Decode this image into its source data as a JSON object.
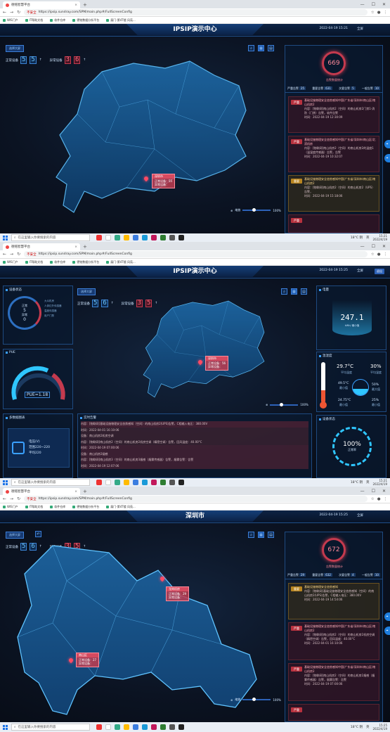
{
  "browser": {
    "tab_title": "德铭智慧平台",
    "url": "https://ipsip.sundray.com/SPM/main.php#/FullScreenConfig",
    "not_secure": "不安全",
    "new_tab": "+",
    "back": "←",
    "forward": "→",
    "reload": "↻",
    "home": "⌂",
    "minimize": "—",
    "maximize": "☐",
    "close": "✕",
    "tab_close": "×",
    "bookmarks": [
      "WIS门户",
      "IT帮助文档",
      "软件仓库",
      "德铭数据分析平台",
      "厦门-第4T楼 风苑..."
    ]
  },
  "taskbar": {
    "search_placeholder": "在这里输入你要搜索的内容",
    "weather": "18°C 阴",
    "lang": "英",
    "times": [
      {
        "time": "15:21",
        "date": "2022/4/19"
      },
      {
        "time": "15:21",
        "date": "2022/4/19"
      },
      {
        "time": "15:25",
        "date": "2022/4/19"
      }
    ]
  },
  "screen1": {
    "title": "IPSIP演示中心",
    "datetime": "2022-04-19  15:21",
    "fullscreen": "全屏",
    "select_btn": "选择大屏",
    "normal_label": "正常设备",
    "normal_digits": [
      "5",
      "5"
    ],
    "abnormal_label": "异常设备",
    "abnormal_digits": [
      "3",
      "6"
    ],
    "arrow": "↑",
    "ring_value": "669",
    "ring_label": "告警数量统计",
    "levels": [
      {
        "l": "严重告警",
        "v": "25"
      },
      {
        "l": "重要告警",
        "v": "631"
      },
      {
        "l": "次要告警",
        "v": "5"
      },
      {
        "l": "一般告警",
        "v": "10"
      }
    ],
    "popup": {
      "title": "深圳市",
      "normal": "正常设备：55",
      "abnormal": "异常设备："
    },
    "alerts": [
      {
        "badge": "严重",
        "color": "red",
        "title": "基础设施物理安全态势感知中国/广东省/深圳市/南山区/南山机房2",
        "body": "内容：[物联网]南山机房2（空间）的南山机房2门禁1-消防（门禁）告警，软件告警",
        "time": "时间：2022-04-19 12:30:09"
      },
      {
        "badge": "严重",
        "color": "red",
        "title": "基础设施物理安全态势感知中国/广东省/深圳市/南山区/北滨机房",
        "body": "内容：[物联网]南山机房2（空间）的南山机房2的温度1（温湿度传感器）告警，告警",
        "time": "时间：2022-04-19 10:32:07"
      },
      {
        "badge": "重要",
        "color": "gold",
        "title": "基础设施物理安全态势感知中国/广东省/深圳市/南山区/南山机房2",
        "body": "内容：[物联网]南山机房2（空间）的南山机房2（UPS）告警，",
        "time": "时间：2022-04-19 15:18:06"
      },
      {
        "badge": "严重",
        "color": "red",
        "title": "",
        "body": "",
        "time": ""
      }
    ],
    "zoom": "100%",
    "zoom_label": "缩放"
  },
  "screen2": {
    "title": "IPSIP演示中心",
    "datetime": "2022-04-19  15:25",
    "fullscreen": "全屏",
    "exit": "退出",
    "select_btn": "选择大屏",
    "normal_label": "正常设备",
    "normal_digits": [
      "5",
      "6"
    ],
    "abnormal_label": "异常设备",
    "abnormal_digits": [
      "3",
      "5"
    ],
    "arrow": "↑",
    "dev_status": {
      "title": "设备状态",
      "normal_label": "正常",
      "normal": "5",
      "abn_label": "异常",
      "abn": "0",
      "legend": [
        "大众机房",
        "人体红外传感器",
        "温度传感器",
        "用户门禁"
      ]
    },
    "pue": {
      "title": "PUE",
      "value": "PUE=1.18"
    },
    "multi": {
      "title": "多数据图表",
      "label": "电压(V)",
      "range": "范围220~220",
      "avg": "平均220"
    },
    "realtime": {
      "title": "实时告警",
      "rows": [
        {
          "t": "内容：[物联网]基础设施物理安全态势感知（空间）的南山机房2(UPS)告警，C相输入电压：380.00V"
        },
        {
          "t": "时间：2022-04-01 16:10:06"
        },
        {
          "t": "设备：南山机房2机房空调"
        },
        {
          "t": "内容：[物联网]南山机房2（空间）的南山机房2机房空调（精密空调）告警，回风温度：40.00°C"
        },
        {
          "t": "时间：2022-04-19 07:00:06"
        },
        {
          "t": "设备：南山机房2烟感"
        },
        {
          "t": "内容：[物联网]南山机房3（空间）的南山机房3烟感（烟雾传感器）告警，烟雾告警：告警"
        },
        {
          "t": "时间：2022-04-19 12:07:06"
        }
      ]
    },
    "power": {
      "title": "电量",
      "value": "247.1",
      "unit": "kWh/ 最小值"
    },
    "temp": {
      "title": "温湿度",
      "temp": "29.7°C",
      "avg": "平均温度",
      "min_t": "49.5°C",
      "min_l": "最小值",
      "low_t": "24.75°C",
      "hum": "30%",
      "hum_avg": "平均湿度",
      "h2": "50%",
      "h2l": "最大值",
      "h3": "25%",
      "h3l": "最小值"
    },
    "devstate": {
      "title": "设备状态",
      "value": "100%",
      "label": "正常率"
    },
    "popup": {
      "title": "深圳市",
      "normal": "正常设备：56",
      "abnormal": "异常设备："
    },
    "zoom": "100%"
  },
  "screen3": {
    "title": "深圳市",
    "datetime": "2022-04-19  15:25",
    "fullscreen": "全屏",
    "select_btn": "选择大屏",
    "normal_label": "正常设备",
    "normal_digits": [
      "5",
      "6"
    ],
    "abnormal_label": "异常设备",
    "abnormal_digits": [
      "3",
      "5"
    ],
    "arrow": "↑",
    "ring_value": "672",
    "ring_label": "告警数量统计",
    "levels": [
      {
        "l": "严重告警",
        "v": "29"
      },
      {
        "l": "重要告警",
        "v": "632"
      },
      {
        "l": "次要告警",
        "v": "4"
      },
      {
        "l": "一般告警",
        "v": "10"
      }
    ],
    "popup1": {
      "title": "龙岗机房",
      "normal": "正常设备：29",
      "abnormal": "异常设备："
    },
    "popup2": {
      "title": "南山区",
      "normal": "正常设备：27",
      "abnormal": "异常设备："
    },
    "alerts": [
      {
        "badge": "重要",
        "color": "gold",
        "title": "基础设施物理安全态势感知",
        "body": "内容：[物联网]基础设施物理安全态势感知（空间）的南山机房2(UPS)告警，C相输入电压：380.00V",
        "time": "时间：2022-04-19 14:54:06"
      },
      {
        "badge": "严重",
        "color": "red",
        "title": "基础设施物理安全态势感知中国/广东省/深圳市/南山区/南山机房2",
        "body": "内容：[物联网]南山机房2（空间）的南山机房2机房空调（精密空调）告警，回风温度：40.00°C",
        "time": "时间：2022-04-01 16:10:06"
      },
      {
        "badge": "严重",
        "color": "red",
        "title": "基础设施物理安全态势感知中国/广东省/深圳市/南山区/南山机房2",
        "body": "内容：[物联网]南山机房2（空间）的南山机房2烟感（烟雾传感器）告警，烟雾告警：告警",
        "time": "时间：2022-04-19 07:00:06"
      },
      {
        "badge": "严重",
        "color": "red",
        "title": "",
        "body": "",
        "time": ""
      }
    ],
    "zoom": "100%",
    "zoom_label": "缩放"
  },
  "colors": {
    "accent": "#3c7fd8",
    "alarm": "#c43a4e",
    "gold": "#b98520",
    "bg": "#0a0f1c"
  }
}
